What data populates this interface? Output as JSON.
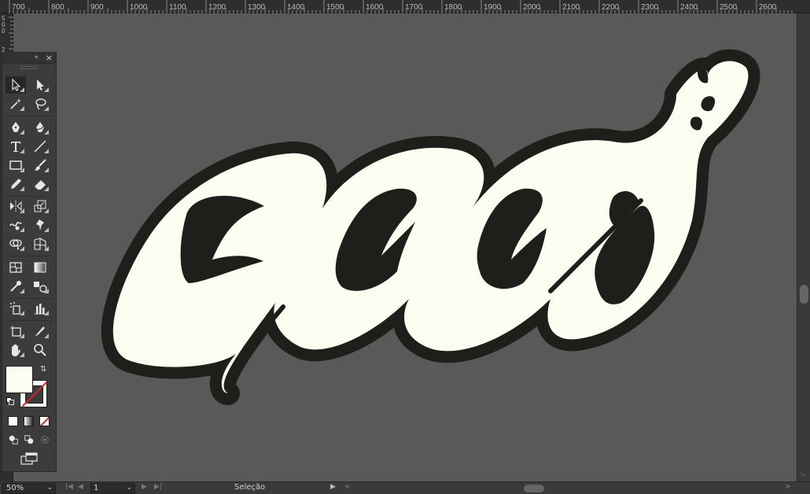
{
  "ruler": {
    "top_labels": [
      "700",
      "800",
      "900",
      "1000",
      "1100",
      "1200",
      "1300",
      "1400",
      "1500",
      "1600",
      "1700",
      "1800",
      "1900",
      "2000",
      "2100",
      "2200",
      "2300",
      "2400",
      "2500",
      "2600"
    ],
    "left_labels": [
      "5",
      "0",
      "0",
      "2"
    ]
  },
  "toolbox": {
    "collapse_icon": "«",
    "close_icon": "×",
    "tools": [
      {
        "name": "selection-tool-icon",
        "row": 0,
        "col": "left",
        "active": true
      },
      {
        "name": "direct-selection-tool-icon",
        "row": 0,
        "col": "right"
      },
      {
        "name": "magic-wand-tool-icon",
        "row": 1,
        "col": "left"
      },
      {
        "name": "lasso-tool-icon",
        "row": 1,
        "col": "right"
      },
      {
        "name": "pen-tool-icon",
        "row": 2,
        "col": "left"
      },
      {
        "name": "curvature-tool-icon",
        "row": 2,
        "col": "right"
      },
      {
        "name": "type-tool-icon",
        "row": 3,
        "col": "left"
      },
      {
        "name": "line-segment-tool-icon",
        "row": 3,
        "col": "right"
      },
      {
        "name": "rectangle-tool-icon",
        "row": 4,
        "col": "left"
      },
      {
        "name": "paintbrush-tool-icon",
        "row": 4,
        "col": "right"
      },
      {
        "name": "pencil-tool-icon",
        "row": 5,
        "col": "left"
      },
      {
        "name": "eraser-tool-icon",
        "row": 5,
        "col": "right"
      },
      {
        "name": "reflect-tool-icon",
        "row": 6,
        "col": "left"
      },
      {
        "name": "scale-tool-icon",
        "row": 6,
        "col": "right"
      },
      {
        "name": "warp-tool-icon",
        "row": 7,
        "col": "left"
      },
      {
        "name": "puppet-warp-tool-icon",
        "row": 7,
        "col": "right"
      },
      {
        "name": "shape-builder-tool-icon",
        "row": 8,
        "col": "left"
      },
      {
        "name": "perspective-grid-tool-icon",
        "row": 8,
        "col": "right"
      },
      {
        "name": "mesh-tool-icon",
        "row": 9,
        "col": "left"
      },
      {
        "name": "gradient-tool-icon",
        "row": 9,
        "col": "right"
      },
      {
        "name": "eyedropper-tool-icon",
        "row": 10,
        "col": "left"
      },
      {
        "name": "blend-tool-icon",
        "row": 10,
        "col": "right"
      },
      {
        "name": "symbol-sprayer-tool-icon",
        "row": 11,
        "col": "left"
      },
      {
        "name": "column-graph-tool-icon",
        "row": 11,
        "col": "right"
      },
      {
        "name": "artboard-tool-icon",
        "row": 12,
        "col": "left"
      },
      {
        "name": "slice-tool-icon",
        "row": 12,
        "col": "right"
      },
      {
        "name": "hand-tool-icon",
        "row": 13,
        "col": "left"
      },
      {
        "name": "zoom-tool-icon",
        "row": 13,
        "col": "right"
      }
    ],
    "fill_color": "#fdfcf0",
    "stroke_color": "none"
  },
  "artwork": {
    "fill_color": "#fdfcf0",
    "outline_color": "#1e1e1b",
    "background_color": "#595959"
  },
  "statusbar": {
    "zoom": "50%",
    "page": "1",
    "status_text": "Seleção",
    "dropdown_icon": "chevron-down-icon"
  }
}
